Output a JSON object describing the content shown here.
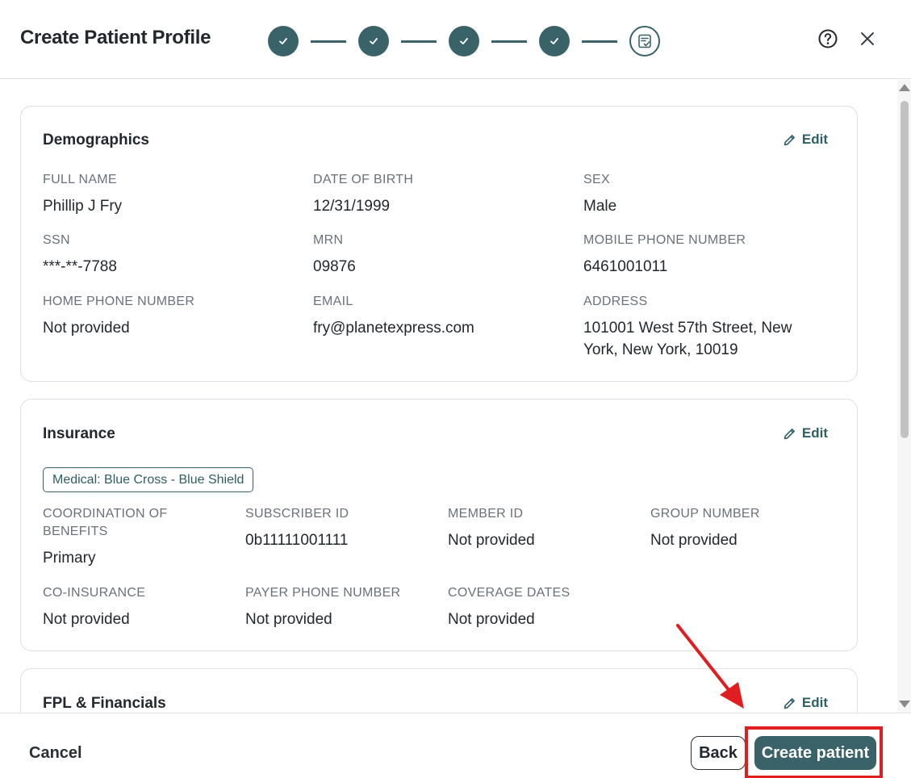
{
  "header": {
    "title": "Create Patient Profile",
    "steps": [
      "complete",
      "complete",
      "complete",
      "complete",
      "current"
    ]
  },
  "demographics": {
    "title": "Demographics",
    "edit_label": "Edit",
    "fields": [
      {
        "label": "FULL NAME",
        "value": "Phillip J Fry"
      },
      {
        "label": "DATE OF BIRTH",
        "value": "12/31/1999"
      },
      {
        "label": "SEX",
        "value": "Male"
      },
      {
        "label": "SSN",
        "value": "***-**-7788"
      },
      {
        "label": "MRN",
        "value": "09876"
      },
      {
        "label": "MOBILE PHONE NUMBER",
        "value": "6461001011"
      },
      {
        "label": "HOME PHONE NUMBER",
        "value": "Not provided"
      },
      {
        "label": "EMAIL",
        "value": "fry@planetexpress.com"
      },
      {
        "label": "ADDRESS",
        "value": "101001 West 57th Street, New York, New York, 10019"
      }
    ]
  },
  "insurance": {
    "title": "Insurance",
    "edit_label": "Edit",
    "tag": "Medical: Blue Cross - Blue Shield",
    "fields": [
      {
        "label": "COORDINATION OF BENEFITS",
        "value": "Primary"
      },
      {
        "label": "SUBSCRIBER ID",
        "value": "0b11111001111"
      },
      {
        "label": "MEMBER ID",
        "value": "Not provided"
      },
      {
        "label": "GROUP NUMBER",
        "value": "Not provided"
      },
      {
        "label": "CO-INSURANCE",
        "value": "Not provided"
      },
      {
        "label": "PAYER PHONE NUMBER",
        "value": "Not provided"
      },
      {
        "label": "COVERAGE DATES",
        "value": "Not provided"
      }
    ]
  },
  "fpl": {
    "title": "FPL & Financials",
    "edit_label": "Edit"
  },
  "footer": {
    "cancel_label": "Cancel",
    "back_label": "Back",
    "create_label": "Create patient"
  },
  "colors": {
    "accent": "#3a6369",
    "highlight": "#e01e22"
  }
}
